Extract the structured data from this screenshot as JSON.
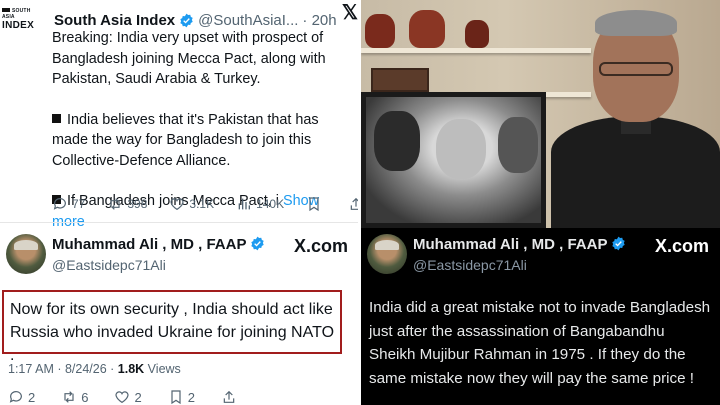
{
  "tweet1": {
    "logo_line1": "SOUTH ASIA",
    "logo_line2": "INDEX",
    "name": "South Asia Index",
    "handle": "@SouthAsiaI...",
    "time": "· 20h",
    "para1": "Breaking: India very upset with prospect of Bangladesh joining Mecca Pact, along with Pakistan, Saudi Arabia & Turkey.",
    "para2": "India believes that it's Pakistan that has made the way for Bangladesh to join this Collective-Defence Alliance.",
    "para3": "If Bangladesh joins Mecca Pact, i",
    "show_more": "Show more",
    "replies": "77",
    "reposts": "398",
    "likes": "3.1K",
    "views": "140K",
    "x_icon": "x-logo-icon"
  },
  "tweet2": {
    "name": "Muhammad Ali , MD , FAAP",
    "handle": "@Eastsidepc71Ali",
    "brand": "X.com",
    "text": "Now for its own security , India should act like Russia who invaded Ukraine for joining  NATO .",
    "time": "1:17 AM · 8/24/26 · ",
    "views_count": "1.8K",
    "views_label": " Views",
    "replies": "2",
    "reposts": "6",
    "likes": "2",
    "bookmarks": "2"
  },
  "tweet3": {
    "name": "Muhammad Ali , MD , FAAP",
    "handle": "@Eastsidepc71Ali",
    "brand": "X.com",
    "text": "India did a great mistake not to invade Bangladesh just after the assassination of Bangabandhu Sheikh Mujibur Rahman in 1975 . If they do the same mistake now they will pay the same price !"
  },
  "colors": {
    "verified": "#1d9bf0",
    "link": "#1d9bf0",
    "highlight_border": "#a11d1d",
    "dark_bg": "#000000"
  }
}
